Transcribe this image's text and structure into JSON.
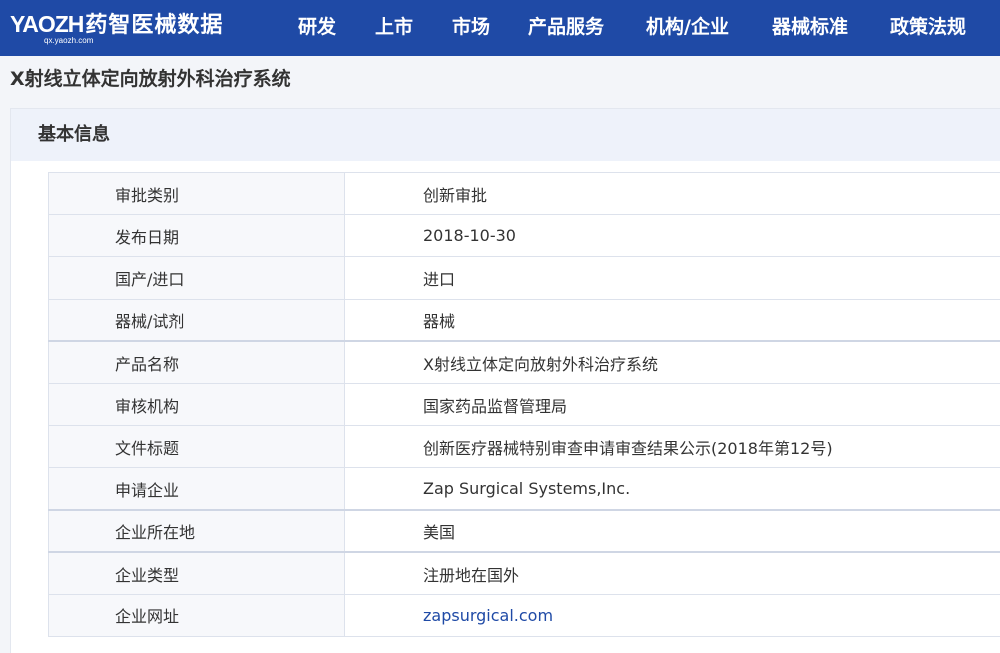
{
  "logo": {
    "brand_en": "YAOZH",
    "brand_cn": "药智医械数据",
    "domain": "qx.yaozh.com"
  },
  "nav": [
    {
      "label": "研发"
    },
    {
      "label": "上市"
    },
    {
      "label": "市场"
    },
    {
      "label": "产品服务"
    },
    {
      "label": "机构/企业"
    },
    {
      "label": "器械标准"
    },
    {
      "label": "政策法规"
    }
  ],
  "page": {
    "title": "X射线立体定向放射外科治疗系统"
  },
  "section": {
    "title": "基本信息"
  },
  "rows": [
    {
      "label": "审批类别",
      "value": "创新审批"
    },
    {
      "label": "发布日期",
      "value": "2018-10-30"
    },
    {
      "label": "国产/进口",
      "value": "进口"
    },
    {
      "label": "器械/试剂",
      "value": "器械"
    },
    {
      "label": "产品名称",
      "value": "X射线立体定向放射外科治疗系统"
    },
    {
      "label": "审核机构",
      "value": "国家药品监督管理局"
    },
    {
      "label": "文件标题",
      "value": "创新医疗器械特别审查申请审查结果公示(2018年第12号)"
    },
    {
      "label": "申请企业",
      "value": "Zap Surgical Systems,Inc."
    },
    {
      "label": "企业所在地",
      "value": "美国"
    },
    {
      "label": "企业类型",
      "value": "注册地在国外"
    },
    {
      "label": "企业网址",
      "value": "zapsurgical.com"
    }
  ],
  "colors": {
    "nav_bg": "#1f4aa6",
    "link": "#1f4aa6",
    "header_bg": "#eef2fa"
  }
}
